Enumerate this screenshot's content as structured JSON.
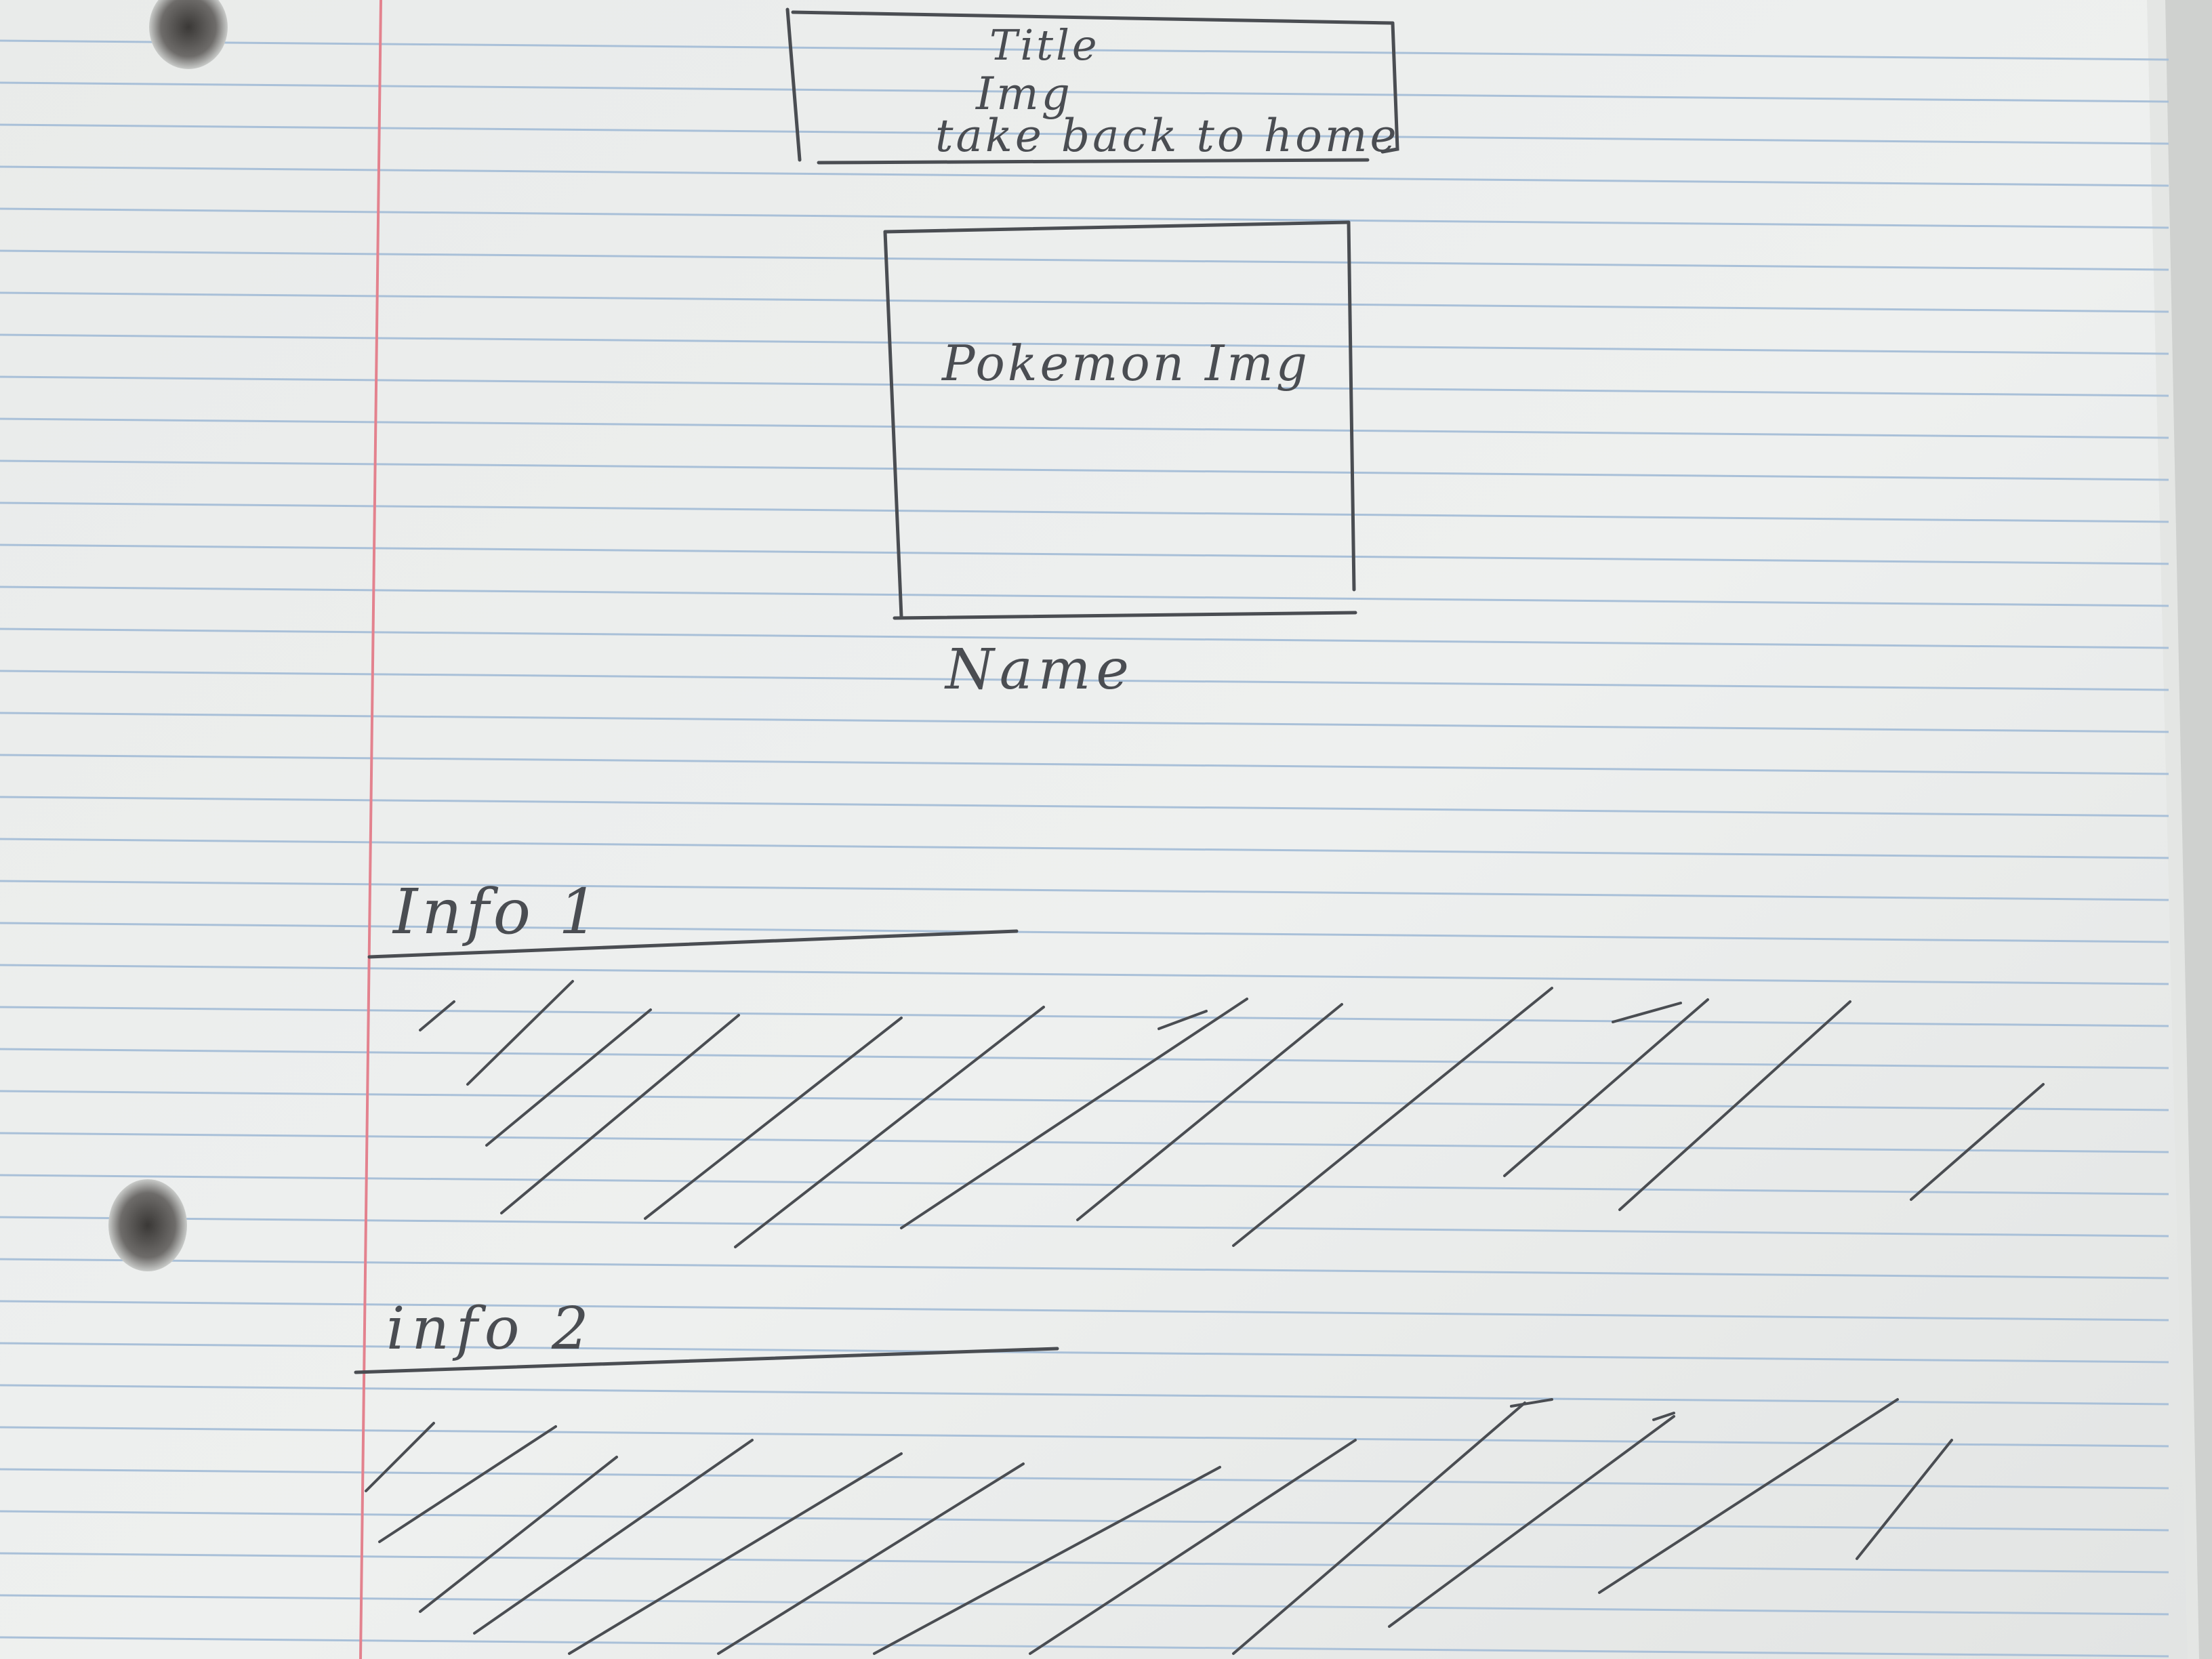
{
  "sketch": {
    "header_box": {
      "title_text": "Title",
      "img_text": "Img",
      "link_text": "take back to home"
    },
    "image_box": {
      "label": "Pokemon Img"
    },
    "name_label": "Name",
    "sections": [
      {
        "label": "Info 1"
      },
      {
        "label": "info 2"
      }
    ]
  },
  "colors": {
    "paper": "#eef0ee",
    "ruled_line": "#a9c0d8",
    "margin_line": "#e3828e",
    "pencil": "#4a4d52",
    "background": "#5a5048"
  }
}
